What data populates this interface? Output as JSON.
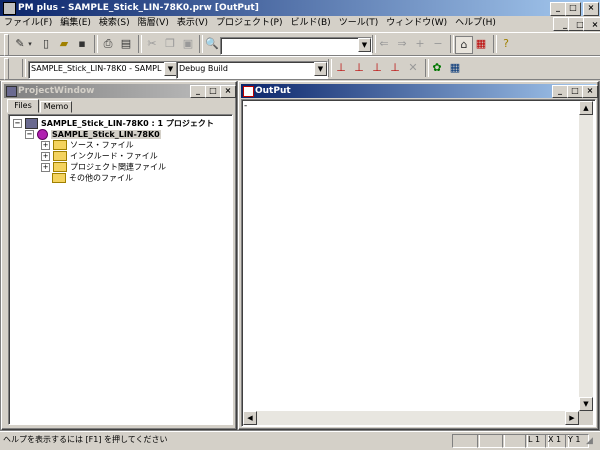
{
  "window": {
    "title": "PM plus - SAMPLE_Stick_LIN-78K0.prw [OutPut]",
    "caption_buttons": [
      "_",
      "□",
      "×"
    ]
  },
  "menu": [
    "ファイル(F)",
    "編集(E)",
    "検索(S)",
    "階層(V)",
    "表示(V)",
    "プロジェクト(P)",
    "ビルド(B)",
    "ツール(T)",
    "ウィンドウ(W)",
    "ヘルプ(H)"
  ],
  "toolbar1": {
    "search_value": "",
    "icons": [
      "open-project-icon",
      "new-icon",
      "open-icon",
      "save-icon",
      "print-icon",
      "print-preview-icon",
      "cut-icon",
      "copy-icon",
      "paste-icon",
      "find-icon",
      "back-icon",
      "forward-icon",
      "add-icon",
      "remove-icon",
      "project-icon",
      "build-settings-icon",
      "help-icon"
    ]
  },
  "toolbar2": {
    "project_value": "SAMPLE_Stick_LIN-78K0 - SAMPL",
    "build_value": "Debug Build"
  },
  "project_window": {
    "title": "ProjectWindow",
    "tabs": [
      "Files",
      "Memo"
    ],
    "tree": {
      "root": "SAMPLE_Stick_LIN-78K0 : 1 プロジェクト",
      "project": "SAMPLE_Stick_LIN-78K0",
      "folders": [
        "ソース・ファイル",
        "インクルード・ファイル",
        "プロジェクト関連ファイル",
        "その他のファイル"
      ]
    }
  },
  "output_window": {
    "title": "OutPut",
    "content": "-"
  },
  "statusbar": {
    "help_text": "ヘルプを表示するには [F1] を押してください",
    "line": "L 1",
    "col": "X 1",
    "y": "Y 1"
  }
}
